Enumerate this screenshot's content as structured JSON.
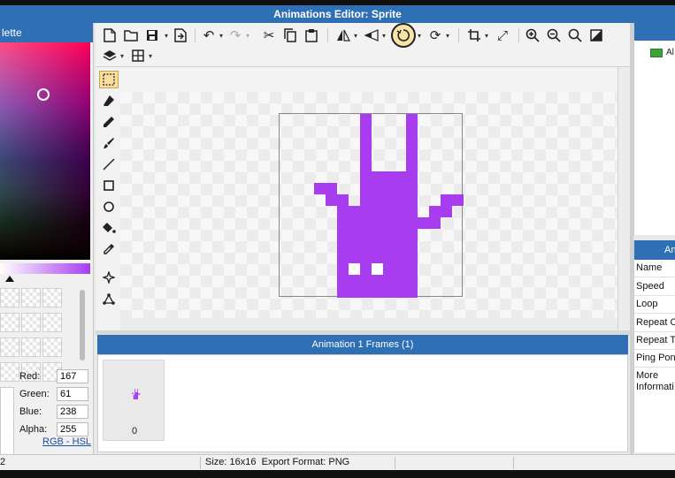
{
  "window": {
    "title": "Animations Editor: Sprite"
  },
  "palette": {
    "header": "lette",
    "color": {
      "red_label": "Red:",
      "red": "167",
      "green_label": "Green:",
      "green": "61",
      "blue_label": "Blue:",
      "blue": "238",
      "alpha_label": "Alpha:",
      "alpha": "255"
    },
    "mode_rgb": "RGB",
    "mode_sep": "-",
    "mode_hsl": "HSL",
    "current_color": "#a73dee"
  },
  "toolbar": {
    "icons": [
      "new-file-icon",
      "open-folder-icon",
      "save-icon",
      "export-icon",
      "undo-icon",
      "redo-icon",
      "cut-icon",
      "copy-icon",
      "paste-icon",
      "flip-horizontal-icon",
      "flip-vertical-icon",
      "rotate-icon",
      "rotate-cw-icon",
      "crop-icon",
      "resize-icon",
      "zoom-in-icon",
      "zoom-out-icon",
      "zoom-fit-icon",
      "toggle-bg-icon",
      "layers-icon",
      "grid-icon"
    ]
  },
  "tools": {
    "icons": [
      "rect-select-icon",
      "eraser-icon",
      "pencil-icon",
      "brush-icon",
      "line-icon",
      "rectangle-icon",
      "ellipse-icon",
      "fill-icon",
      "eyedropper-icon",
      "magic-wand-icon",
      "transform-icon"
    ]
  },
  "frames": {
    "header": "Animation 1 Frames (1)",
    "items": [
      {
        "index": "0"
      }
    ]
  },
  "layers": {
    "items": [
      {
        "label": "Al"
      }
    ]
  },
  "properties": {
    "header": "Ani",
    "rows": [
      "Name",
      "Speed",
      "Loop",
      "Repeat C",
      "Repeat T",
      "Ping Pon",
      "More",
      "Informati"
    ]
  },
  "status": {
    "left": "2",
    "size": "Size: 16x16",
    "format": "Export Format: PNG"
  }
}
